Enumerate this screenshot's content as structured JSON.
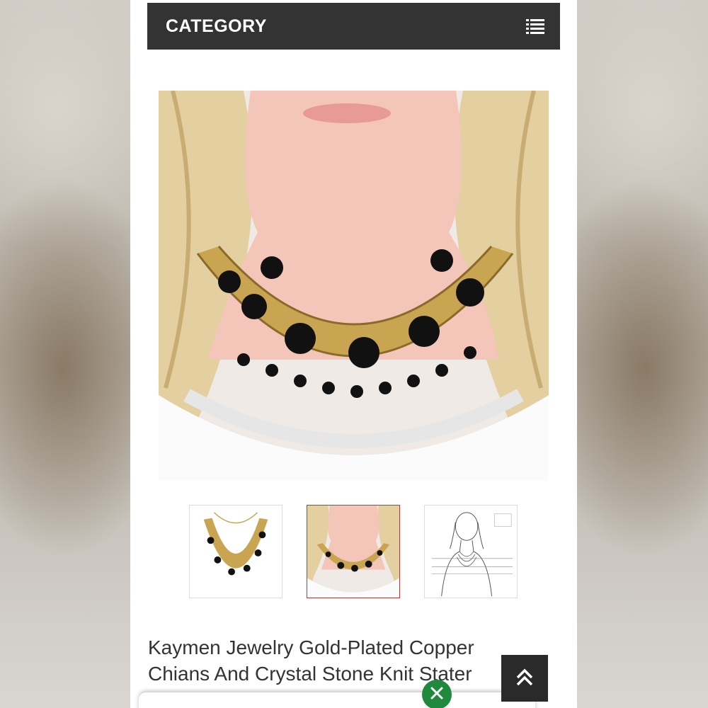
{
  "header": {
    "category_label": "CATEGORY",
    "menu_icon": "list-icon"
  },
  "product": {
    "title_line1": "Kaymen Jewelry Gold-Plated Copper",
    "title_line2": "Chians And Crystal Stone Knit Stater",
    "main_image": "necklace-on-mannequin-photo",
    "thumbnails": [
      {
        "name": "necklace-flat-photo",
        "active": false
      },
      {
        "name": "necklace-on-mannequin-photo",
        "active": true
      },
      {
        "name": "necklace-size-sketch",
        "active": false
      }
    ]
  },
  "controls": {
    "scroll_top_icon": "double-chevron-up-icon",
    "close_icon": "close-icon"
  },
  "colors": {
    "header_bg": "#333333",
    "active_thumb_border": "#b23a3a",
    "close_button": "#1f8a3e"
  }
}
